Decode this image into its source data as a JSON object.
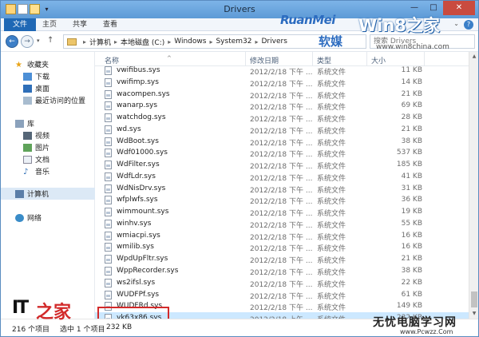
{
  "window": {
    "title": "Drivers"
  },
  "ribbon": {
    "tabs": [
      "文件",
      "主页",
      "共享",
      "查看"
    ]
  },
  "address": {
    "breadcrumb": [
      "计算机",
      "本地磁盘 (C:)",
      "Windows",
      "System32",
      "Drivers"
    ],
    "search_placeholder": "搜索 Drivers"
  },
  "sidebar": {
    "favorites": "收藏夹",
    "downloads": "下载",
    "desktop": "桌面",
    "recent": "最近访问的位置",
    "libraries": "库",
    "videos": "视频",
    "pictures": "图片",
    "documents": "文档",
    "music": "音乐",
    "computer": "计算机",
    "network": "网络"
  },
  "columns": {
    "name": "名称",
    "date": "修改日期",
    "type": "类型",
    "size": "大小"
  },
  "files": [
    {
      "name": "vwifibus.sys",
      "date": "2012/2/18 下午 ...",
      "type": "系统文件",
      "size": "11 KB"
    },
    {
      "name": "vwifimp.sys",
      "date": "2012/2/18 下午 ...",
      "type": "系统文件",
      "size": "14 KB"
    },
    {
      "name": "wacompen.sys",
      "date": "2012/2/18 下午 ...",
      "type": "系统文件",
      "size": "21 KB"
    },
    {
      "name": "wanarp.sys",
      "date": "2012/2/18 下午 ...",
      "type": "系统文件",
      "size": "69 KB"
    },
    {
      "name": "watchdog.sys",
      "date": "2012/2/18 下午 ...",
      "type": "系统文件",
      "size": "28 KB"
    },
    {
      "name": "wd.sys",
      "date": "2012/2/18 下午 ...",
      "type": "系统文件",
      "size": "21 KB"
    },
    {
      "name": "WdBoot.sys",
      "date": "2012/2/18 下午 ...",
      "type": "系统文件",
      "size": "38 KB"
    },
    {
      "name": "Wdf01000.sys",
      "date": "2012/2/18 下午 ...",
      "type": "系统文件",
      "size": "537 KB"
    },
    {
      "name": "WdFilter.sys",
      "date": "2012/2/18 下午 ...",
      "type": "系统文件",
      "size": "185 KB"
    },
    {
      "name": "WdfLdr.sys",
      "date": "2012/2/18 下午 ...",
      "type": "系统文件",
      "size": "41 KB"
    },
    {
      "name": "WdNisDrv.sys",
      "date": "2012/2/18 下午 ...",
      "type": "系统文件",
      "size": "31 KB"
    },
    {
      "name": "wfplwfs.sys",
      "date": "2012/2/18 下午 ...",
      "type": "系统文件",
      "size": "36 KB"
    },
    {
      "name": "wimmount.sys",
      "date": "2012/2/18 下午 ...",
      "type": "系统文件",
      "size": "19 KB"
    },
    {
      "name": "winhv.sys",
      "date": "2012/2/18 下午 ...",
      "type": "系统文件",
      "size": "55 KB"
    },
    {
      "name": "wmiacpi.sys",
      "date": "2012/2/18 下午 ...",
      "type": "系统文件",
      "size": "16 KB"
    },
    {
      "name": "wmilib.sys",
      "date": "2012/2/18 下午 ...",
      "type": "系统文件",
      "size": "16 KB"
    },
    {
      "name": "WpdUpFltr.sys",
      "date": "2012/2/18 下午 ...",
      "type": "系统文件",
      "size": "21 KB"
    },
    {
      "name": "WppRecorder.sys",
      "date": "2012/2/18 下午 ...",
      "type": "系统文件",
      "size": "38 KB"
    },
    {
      "name": "ws2ifsl.sys",
      "date": "2012/2/18 下午 ...",
      "type": "系统文件",
      "size": "22 KB"
    },
    {
      "name": "WUDFPf.sys",
      "date": "2012/2/18 下午 ...",
      "type": "系统文件",
      "size": "61 KB"
    },
    {
      "name": "WUDFRd.sys",
      "date": "2012/2/18 下午 ...",
      "type": "系统文件",
      "size": "149 KB"
    },
    {
      "name": "yk63x86.sys",
      "date": "2012/2/18 上午 ...",
      "type": "系统文件",
      "size": "232 KB"
    }
  ],
  "status": {
    "count": "216 个项目",
    "selected": "选中 1 个项目",
    "size": "232 KB"
  },
  "watermarks": {
    "ruonmei": "RuanMei",
    "ruonmei_cn": "软媒",
    "win8": "Win8之家",
    "win8_url": "www.win8china.com",
    "ithome": "IT",
    "ithome_cn": "之家",
    "bottom": "无忧电脑学习网",
    "bottom_url": "www.Pcwzz.Com"
  },
  "colors": {
    "accent": "#1f68b5",
    "selection": "#cce8ff",
    "highlight_border": "#d22a2a"
  }
}
